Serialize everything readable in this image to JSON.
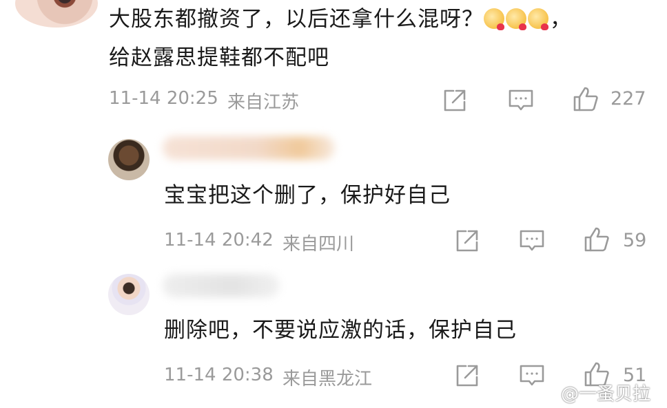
{
  "comment": {
    "line1": "大股东都撤资了，以后还拿什么混呀？",
    "line1_tail": "，",
    "line2": "给赵露思提鞋都不配吧",
    "emoji_icon": "smiling-face-with-hearts-emoji",
    "time": "11-14 20:25",
    "location": "来自江苏",
    "likes": "227"
  },
  "replies": [
    {
      "text": "宝宝把这个删了，保护好自己",
      "time": "11-14 20:42",
      "location": "来自四川",
      "likes": "59"
    },
    {
      "text": "删除吧，不要说应激的话，保护自己",
      "time": "11-14 20:38",
      "location": "来自黑龙江",
      "likes": "51"
    }
  ],
  "watermark": "@一蚤贝拉",
  "icons": {
    "share": "share-icon",
    "comment": "comment-icon",
    "like": "thumbs-up-icon"
  },
  "colors": {
    "text": "#1a1a1a",
    "meta": "#9a9a9a",
    "background": "#ffffff"
  }
}
